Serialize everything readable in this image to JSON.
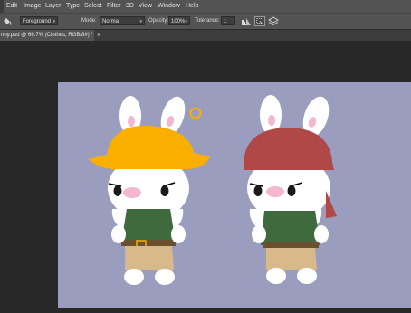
{
  "menu": {
    "items": [
      "Edit",
      "Image",
      "Layer",
      "Type",
      "Select",
      "Filter",
      "3D",
      "View",
      "Window",
      "Help"
    ]
  },
  "options": {
    "fill_source": "Foreground",
    "mode_label": "Mode:",
    "mode_value": "Normal",
    "opacity_label": "Opacity:",
    "opacity_value": "100%",
    "tolerance_label": "Tolerance:",
    "tolerance_value": "1"
  },
  "document": {
    "tab_title": "nny.psd @ 66.7% (Clothes, RGB/8#) *",
    "close": "×"
  },
  "colors": {
    "canvas_bg": "#9a9dbd",
    "yellow_hat": "#f9ae00",
    "red_bandana": "#b04848",
    "green_shirt": "#3f6a3e",
    "tan_pants": "#d7b98a",
    "pink_cheek": "#f5b6cf"
  },
  "icons": [
    "paint-bucket-icon",
    "chevron-down-icon",
    "anti-alias-icon",
    "contiguous-icon",
    "all-layers-icon"
  ]
}
